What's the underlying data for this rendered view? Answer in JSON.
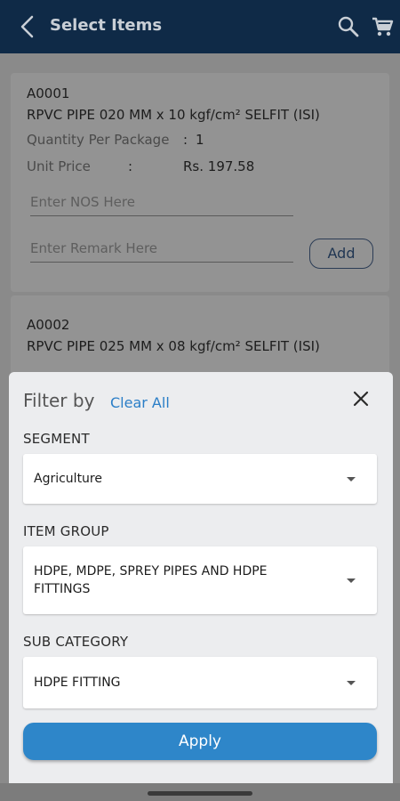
{
  "appbar": {
    "title": "Select Items",
    "icons": [
      "back-arrow-icon",
      "search-icon",
      "cart-icon"
    ]
  },
  "items": [
    {
      "code": "A0001",
      "name": "RPVC PIPE 020 MM x 10 kgf/cm² SELFIT (ISI)",
      "qty_label": "Quantity Per Package",
      "qty_sep": ":",
      "qty_value": "1",
      "price_label": "Unit Price",
      "price_sep": ":",
      "price_value": "Rs. 197.58",
      "nos_placeholder": "Enter NOS Here",
      "remark_placeholder": "Enter Remark Here",
      "add_label": "Add"
    },
    {
      "code": "A0002",
      "name": "RPVC PIPE 025 MM x 08 kgf/cm² SELFIT (ISI)"
    }
  ],
  "filter": {
    "title": "Filter by",
    "clear_all": "Clear All",
    "segment_label": "SEGMENT",
    "segment_value": "Agriculture",
    "item_group_label": "ITEM GROUP",
    "item_group_value": "HDPE, MDPE, SPREY PIPES AND HDPE FITTINGS",
    "sub_category_label": "SUB CATEGORY",
    "sub_category_value": "HDPE FITTING",
    "apply_label": "Apply"
  },
  "colors": {
    "appbar": "#0f2a47",
    "accent": "#2e86c9",
    "link": "#2a7ec7"
  }
}
